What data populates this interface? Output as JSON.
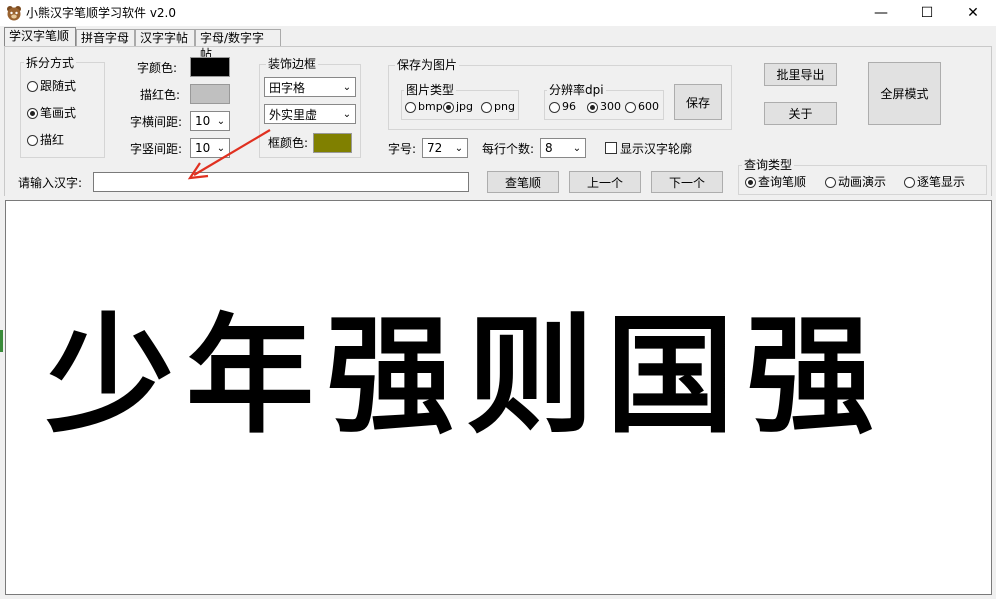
{
  "window": {
    "title": "小熊汉字笔顺学习软件 v2.0",
    "minimize": "—",
    "maximize": "☐",
    "close": "✕"
  },
  "tabs": [
    "学汉字笔顺",
    "拼音字母",
    "汉字字帖",
    "字母/数字字帖"
  ],
  "split": {
    "legend": "拆分方式",
    "options": [
      "跟随式",
      "笔画式",
      "描红"
    ],
    "selected": "笔画式"
  },
  "style": {
    "char_color_label": "字颜色:",
    "char_color": "#000000",
    "trace_color_label": "描红色:",
    "trace_color": "#c0c0c0",
    "h_spacing_label": "字横间距:",
    "h_spacing": "10",
    "v_spacing_label": "字竖间距:",
    "v_spacing": "10"
  },
  "border": {
    "legend": "装饰边框",
    "grid_type": "田字格",
    "line_style": "外实里虚",
    "frame_color_label": "框颜色:",
    "frame_color": "#808000"
  },
  "save": {
    "legend": "保存为图片",
    "image_type_legend": "图片类型",
    "image_types": [
      "bmp",
      "jpg",
      "png"
    ],
    "image_type_selected": "jpg",
    "dpi_legend": "分辨率dpi",
    "dpis": [
      "96",
      "300",
      "600"
    ],
    "dpi_selected": "300",
    "save_button": "保存",
    "font_size_label": "字号:",
    "font_size": "72",
    "per_row_label": "每行个数:",
    "per_row": "8",
    "outline_label": "显示汉字轮廓",
    "outline_checked": false
  },
  "buttons": {
    "batch_export": "批里导出",
    "about": "关于",
    "fullscreen": "全屏模式",
    "lookup": "查笔顺",
    "prev": "上一个",
    "next": "下一个"
  },
  "input": {
    "label": "请输入汉字:",
    "value": ""
  },
  "query": {
    "legend": "查询类型",
    "options": [
      "查询笔顺",
      "动画演示",
      "逐笔显示"
    ],
    "selected": "查询笔顺"
  },
  "display": {
    "text": "少年强则国强"
  },
  "colors": {
    "annotation_arrow": "#e03020"
  }
}
